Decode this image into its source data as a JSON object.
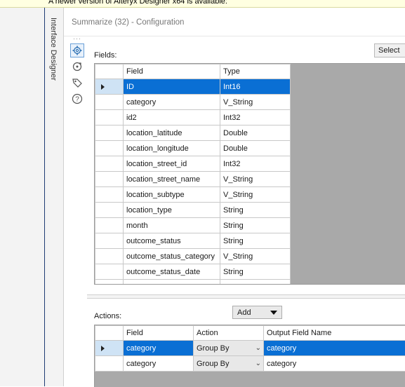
{
  "notice": {
    "text": "A newer version of Alteryx Designer x64 is available:"
  },
  "sidebar": {
    "interface_designer_label": "Interface Designer"
  },
  "config": {
    "title": "Summarize (32) - Configuration",
    "icons": [
      "gear-icon",
      "refresh-icon",
      "tag-icon",
      "help-icon"
    ]
  },
  "fields": {
    "label": "Fields:",
    "select_button": "Select",
    "columns": [
      "Field",
      "Type"
    ],
    "rows": [
      {
        "field": "ID",
        "type": "Int16",
        "selected": true
      },
      {
        "field": "category",
        "type": "V_String"
      },
      {
        "field": "id2",
        "type": "Int32"
      },
      {
        "field": "location_latitude",
        "type": "Double"
      },
      {
        "field": "location_longitude",
        "type": "Double"
      },
      {
        "field": "location_street_id",
        "type": "Int32"
      },
      {
        "field": "location_street_name",
        "type": "V_String"
      },
      {
        "field": "location_subtype",
        "type": "V_String"
      },
      {
        "field": "location_type",
        "type": "String"
      },
      {
        "field": "month",
        "type": "String"
      },
      {
        "field": "outcome_status",
        "type": "String"
      },
      {
        "field": "outcome_status_category",
        "type": "V_String"
      },
      {
        "field": "outcome_status_date",
        "type": "String"
      }
    ]
  },
  "actions": {
    "label": "Actions:",
    "add_button": "Add",
    "columns": [
      "Field",
      "Action",
      "Output Field Name"
    ],
    "rows": [
      {
        "field": "category",
        "action": "Group By",
        "output": "category",
        "selected": true
      },
      {
        "field": "category",
        "action": "Group By",
        "output": "category"
      }
    ]
  },
  "colors": {
    "selection": "#0a6fd4",
    "accent_border": "#1f3c73"
  }
}
